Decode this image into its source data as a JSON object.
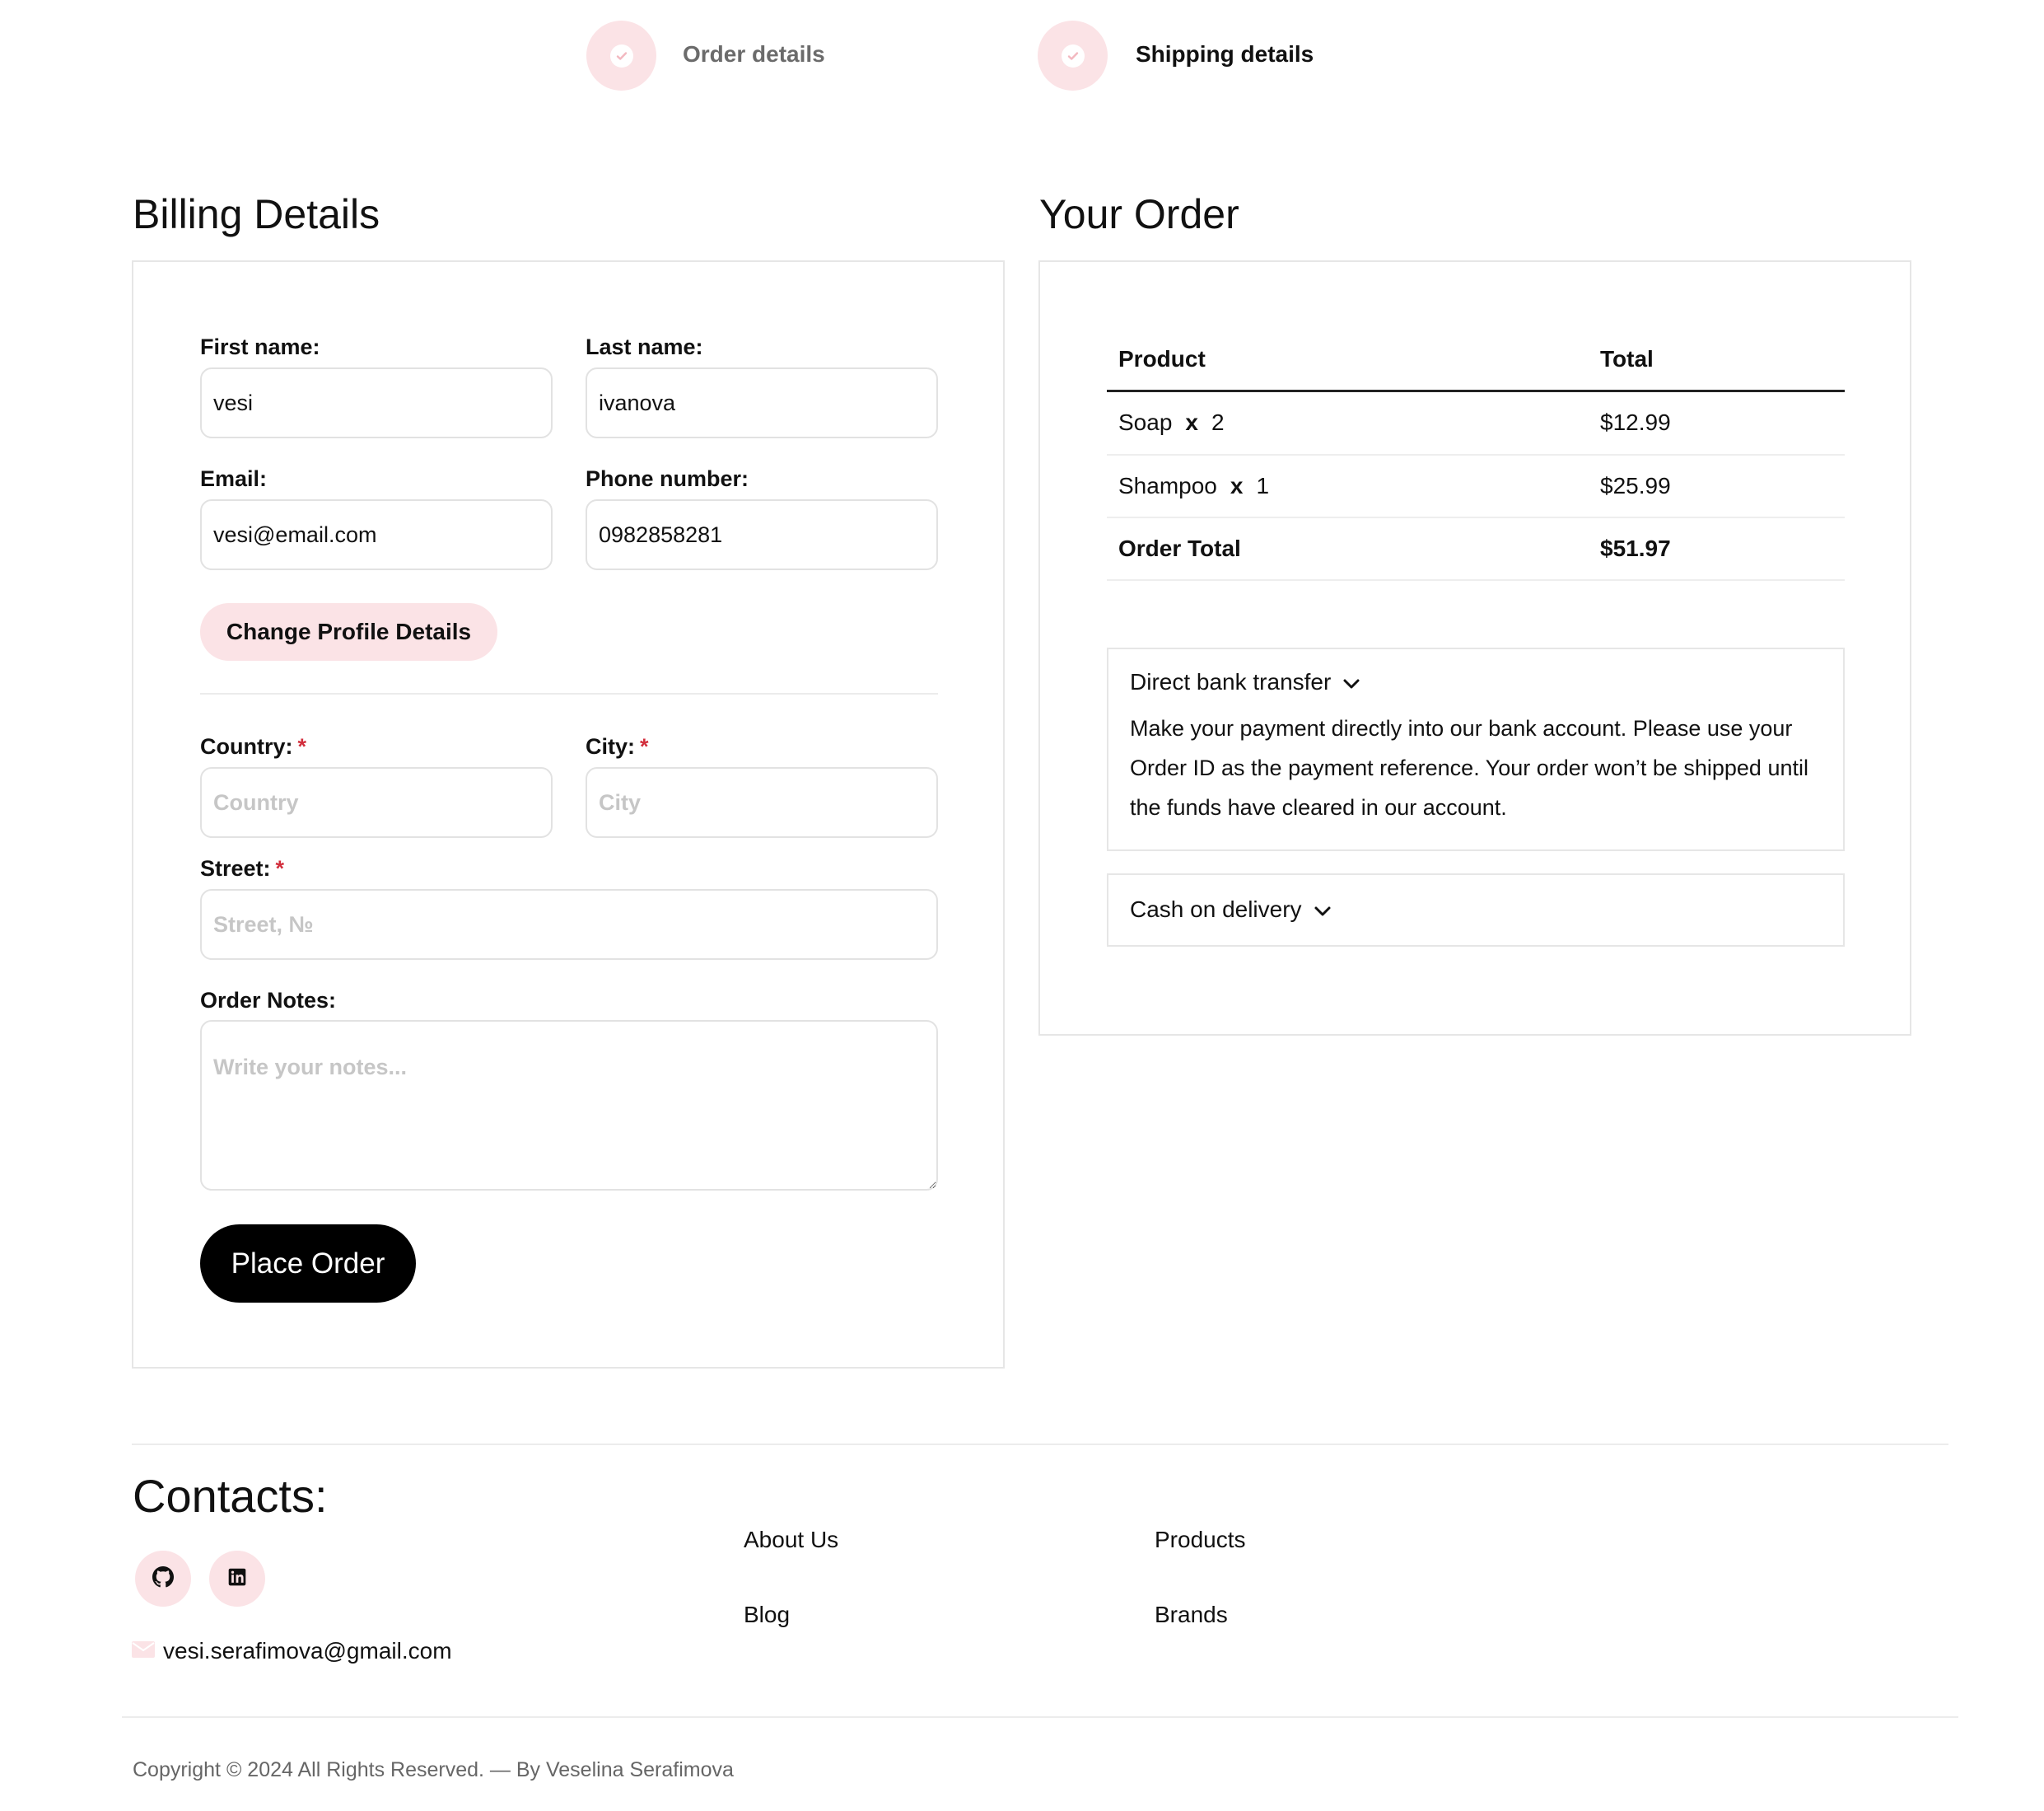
{
  "stepper": {
    "steps": [
      {
        "label": "Order details",
        "color": "#6b6b6b"
      },
      {
        "label": "Shipping details",
        "color": "#111111"
      }
    ]
  },
  "billing": {
    "title": "Billing Details",
    "first_name": {
      "label": "First name:",
      "value": "vesi"
    },
    "last_name": {
      "label": "Last name:",
      "value": "ivanova"
    },
    "email": {
      "label": "Email:",
      "value": "vesi@email.com"
    },
    "phone": {
      "label": "Phone number:",
      "value": "0982858281"
    },
    "change_profile_label": "Change Profile Details",
    "country": {
      "label": "Country:",
      "placeholder": "Country",
      "required_mark": "*"
    },
    "city": {
      "label": "City:",
      "placeholder": "City",
      "required_mark": "*"
    },
    "street": {
      "label": "Street:",
      "placeholder": "Street, №",
      "required_mark": "*"
    },
    "notes": {
      "label": "Order Notes:",
      "placeholder": "Write your notes..."
    },
    "place_order_label": "Place Order"
  },
  "order": {
    "title": "Your Order",
    "columns": [
      "Product",
      "Total"
    ],
    "items": [
      {
        "name": "Soap",
        "x": "x",
        "qty": "2",
        "total": "$12.99"
      },
      {
        "name": "Shampoo",
        "x": "x",
        "qty": "1",
        "total": "$25.99"
      }
    ],
    "total_label": "Order Total",
    "total_value": "$51.97",
    "payment": [
      {
        "title": "Direct bank transfer",
        "description": "Make your payment directly into our bank account. Please use your Order ID as the payment reference. Your order won’t be shipped until the funds have cleared in our account."
      },
      {
        "title": "Cash on delivery"
      }
    ]
  },
  "footer": {
    "contacts_title": "Contacts:",
    "email": "vesi.serafimova@gmail.com",
    "links_col1": [
      "About Us",
      "Blog"
    ],
    "links_col2": [
      "Products",
      "Brands"
    ],
    "copyright": "Copyright © 2024 All Rights Reserved. — By Veselina Serafimova"
  },
  "colors": {
    "accent_pink": "#fbe3e6",
    "required_red": "#d22e3c",
    "primary_black": "#000000"
  }
}
